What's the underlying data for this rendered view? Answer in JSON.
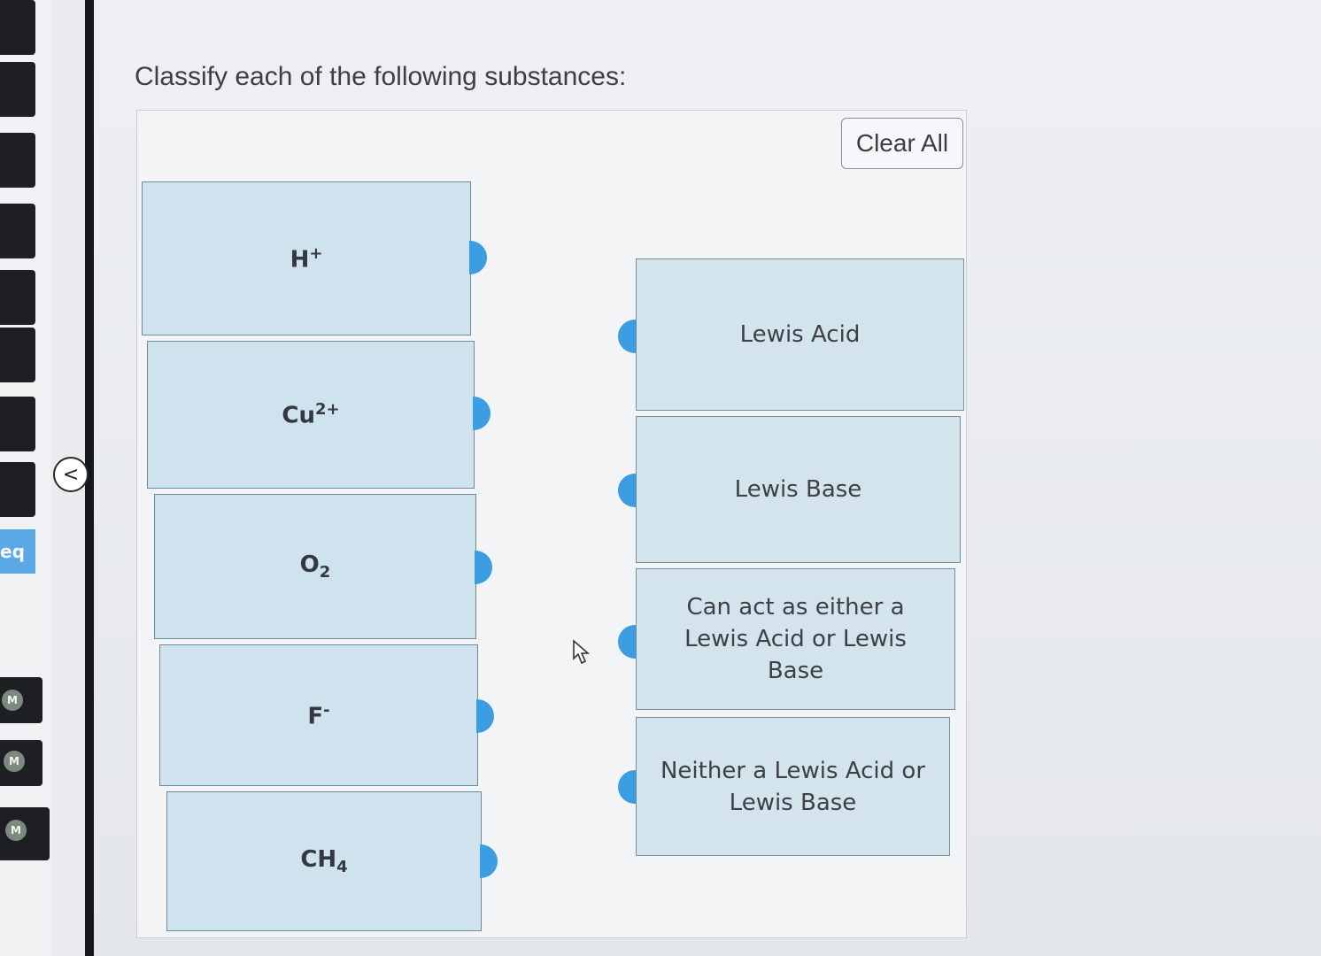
{
  "question": {
    "prompt": "Classify each of the following substances:"
  },
  "toolbar": {
    "clear_label": "Clear All"
  },
  "sidebar": {
    "highlight_label": "eq",
    "badges": [
      "M",
      "M",
      "M"
    ]
  },
  "collapse": {
    "glyph": "<"
  },
  "items": [
    {
      "base": "H",
      "sup": "+",
      "sub": ""
    },
    {
      "base": "Cu",
      "sup": "2+",
      "sub": ""
    },
    {
      "base": "O",
      "sup": "",
      "sub": "2"
    },
    {
      "base": "F",
      "sup": "-",
      "sub": ""
    },
    {
      "base": "CH",
      "sup": "",
      "sub": "4"
    }
  ],
  "targets": [
    {
      "label": "Lewis Acid"
    },
    {
      "label": "Lewis Base"
    },
    {
      "label": "Can act as either a Lewis Acid or Lewis Base"
    },
    {
      "label": "Neither a Lewis Acid or Lewis Base"
    }
  ],
  "colors": {
    "item_bg": "#cfe3ee",
    "handle": "#3b9de2",
    "sidebar_highlight": "#5aa9e6"
  }
}
